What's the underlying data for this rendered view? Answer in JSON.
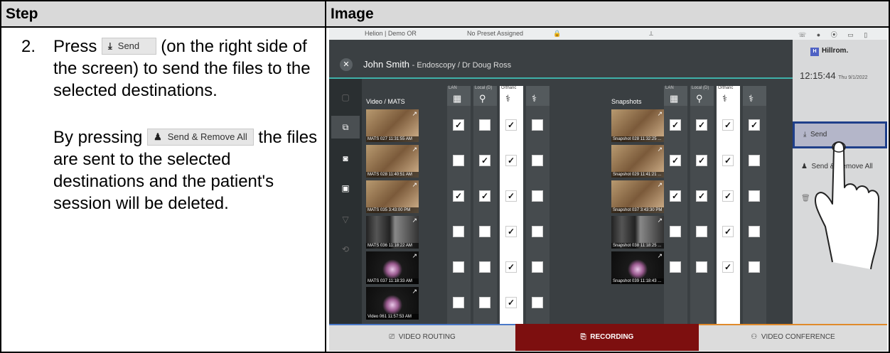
{
  "table": {
    "header_step": "Step",
    "header_image": "Image",
    "step_number": "2.",
    "instruction": {
      "press": "Press",
      "send_chip": "Send",
      "rest": "(on the right side of the screen) to send the files to the selected destinations."
    },
    "note": {
      "by_pressing": "By pressing",
      "remove_chip": "Send & Remove All",
      "rest": "the files are sent to the selected destinations and the patient's session will be deleted."
    }
  },
  "screen": {
    "topbar": {
      "room": "Helion | Demo OR",
      "preset": "No Preset Assigned"
    },
    "patient_name": "John Smith",
    "patient_sub": "- Endoscopy / Dr Doug Ross",
    "logo": "Hillrom.",
    "clock_time": "12:15:44",
    "clock_date": "Thu 9/1/2022",
    "section_video": "Video / MATS",
    "section_snapshots": "Snapshots",
    "col_labels": [
      "LAN",
      "Local (D)",
      "Orthanc",
      ""
    ],
    "video_items": [
      {
        "caption": "MATS 027 11:31:55 AM",
        "kind": "endo",
        "checks": [
          true,
          false,
          true,
          false
        ]
      },
      {
        "caption": "MATS 028 11:40:51 AM",
        "kind": "endo",
        "checks": [
          false,
          true,
          true,
          false
        ]
      },
      {
        "caption": "MATS 035 3:43:00 PM",
        "kind": "endo",
        "checks": [
          true,
          true,
          true,
          false
        ]
      },
      {
        "caption": "MATS 036 11:18:22 AM",
        "kind": "xray",
        "checks": [
          false,
          false,
          true,
          false
        ]
      },
      {
        "caption": "MATS 037 11:18:33 AM",
        "kind": "dark",
        "checks": [
          false,
          false,
          true,
          false
        ]
      },
      {
        "caption": "Video 061 11:57:53 AM",
        "kind": "dark",
        "checks": [
          false,
          false,
          true,
          false
        ]
      }
    ],
    "snapshot_items": [
      {
        "caption": "Snapshot 028 11:32:25 ...",
        "kind": "endo",
        "checks": [
          true,
          true,
          true,
          true
        ]
      },
      {
        "caption": "Snapshot 029 11:41:21 ...",
        "kind": "endo",
        "checks": [
          true,
          true,
          true,
          false
        ]
      },
      {
        "caption": "Snapshot 037 3:43:30 PM",
        "kind": "endo",
        "checks": [
          true,
          true,
          true,
          false
        ]
      },
      {
        "caption": "Snapshot 038 11:18:25 ...",
        "kind": "xray",
        "checks": [
          false,
          false,
          true,
          false
        ]
      },
      {
        "caption": "Snapshot 039 11:18:43 ...",
        "kind": "dark",
        "checks": [
          false,
          false,
          true,
          false
        ]
      }
    ],
    "send_label": "Send",
    "send_remove_label": "Send & Remove All",
    "tabs": {
      "routing": "VIDEO ROUTING",
      "recording": "RECORDING",
      "conference": "VIDEO CONFERENCE"
    },
    "colors": {
      "accent_teal": "#3fb1a9",
      "recording_tab": "#7d0f0f",
      "send_highlight": "#1f3f8a"
    }
  }
}
